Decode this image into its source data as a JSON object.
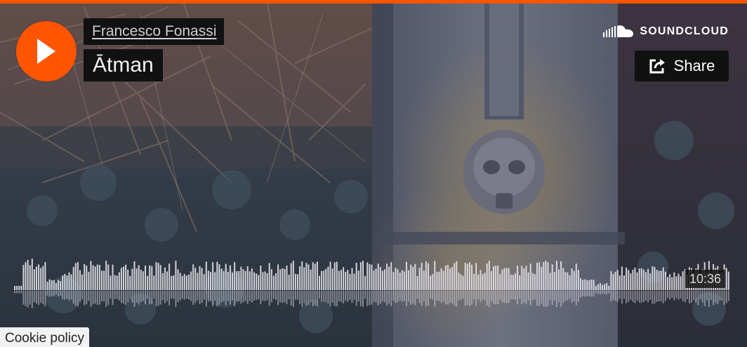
{
  "player": {
    "artist": "Francesco Fonassi",
    "title": "Ātman",
    "duration": "10:36",
    "brand": "SOUNDCLOUD",
    "share_label": "Share",
    "cookie_policy": "Cookie policy",
    "accent_color": "#ff5500"
  },
  "icons": {
    "play": "play-icon",
    "brand_logo": "soundcloud-cloud-icon",
    "share": "share-icon"
  }
}
